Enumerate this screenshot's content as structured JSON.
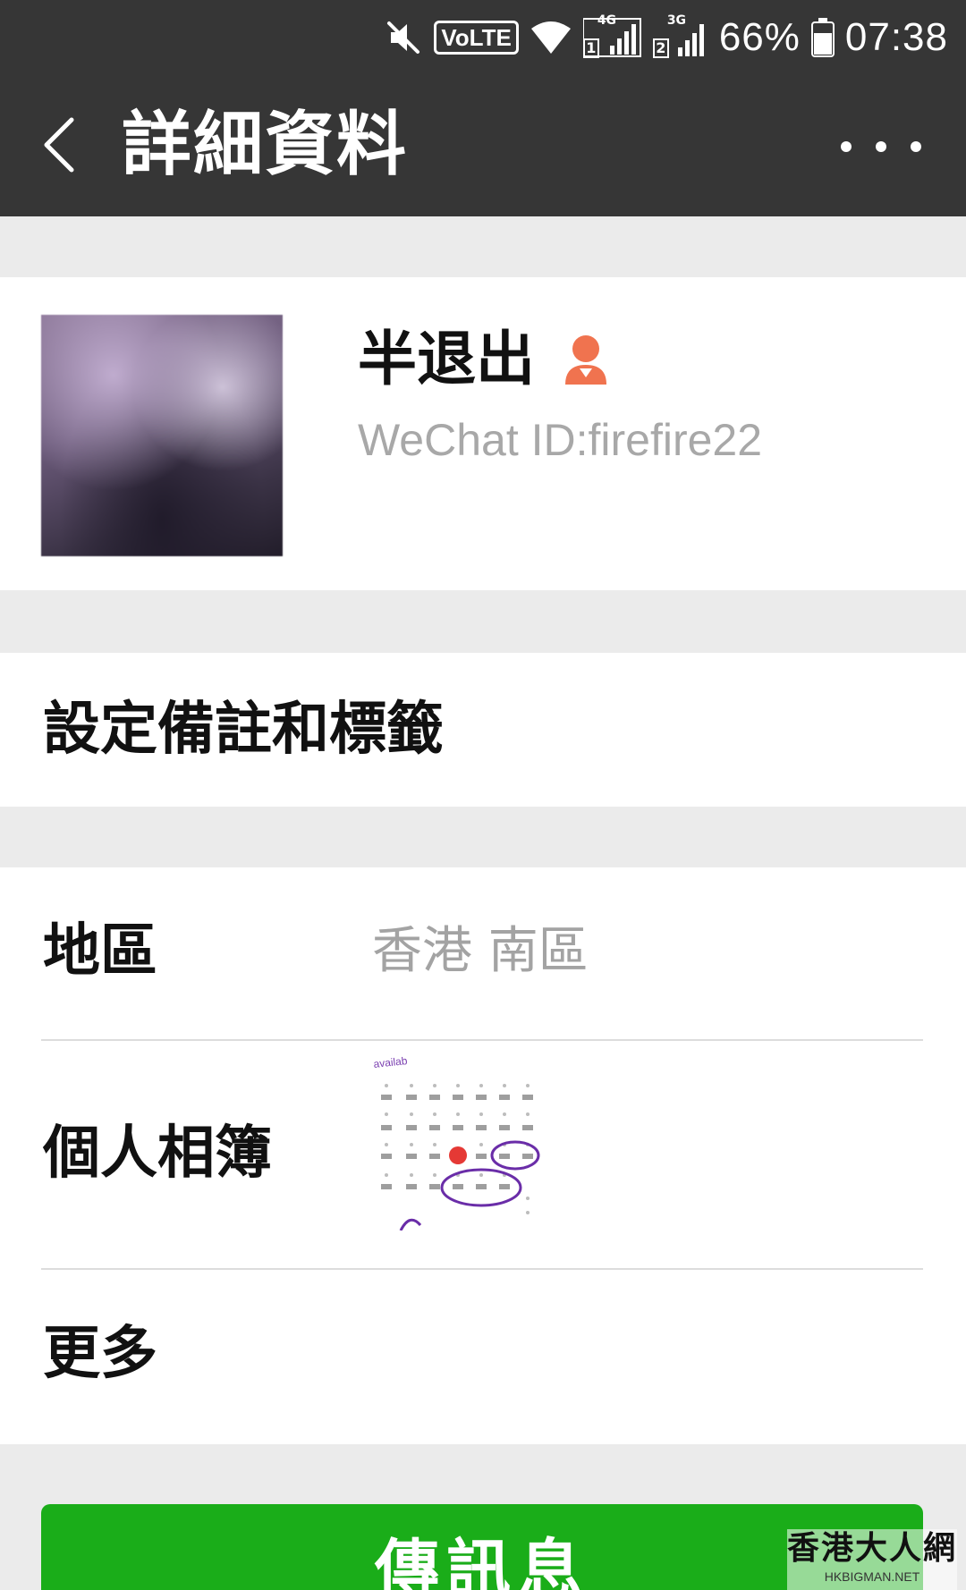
{
  "status_bar": {
    "volte_label": "VoLTE",
    "sim1_network": "4G",
    "sim1_slot": "1",
    "sim2_network": "3G",
    "sim2_slot": "2",
    "battery_percent": "66%",
    "battery_level": 0.66,
    "time": "07:38"
  },
  "header": {
    "title": "詳細資料",
    "back_icon": "chevron-left-icon",
    "more_icon": "more-dots-icon"
  },
  "profile": {
    "nickname": "半退出",
    "gender_icon": "female-user-icon",
    "gender_color": "#f0734f",
    "wechat_id": "WeChat ID:firefire22"
  },
  "remark": {
    "label": "設定備註和標籤"
  },
  "info": {
    "region_label": "地區",
    "region_value": "香港  南區",
    "album_label": "個人相簿",
    "more_label": "更多"
  },
  "send_button": {
    "label": "傳訊息",
    "color": "#1aad19"
  },
  "watermark": {
    "main": "香港大人網",
    "sub": "HKBIGMAN.NET"
  },
  "colors": {
    "bar_background": "#363636",
    "page_background": "#ebebeb",
    "secondary_text": "#a8a8a8"
  }
}
